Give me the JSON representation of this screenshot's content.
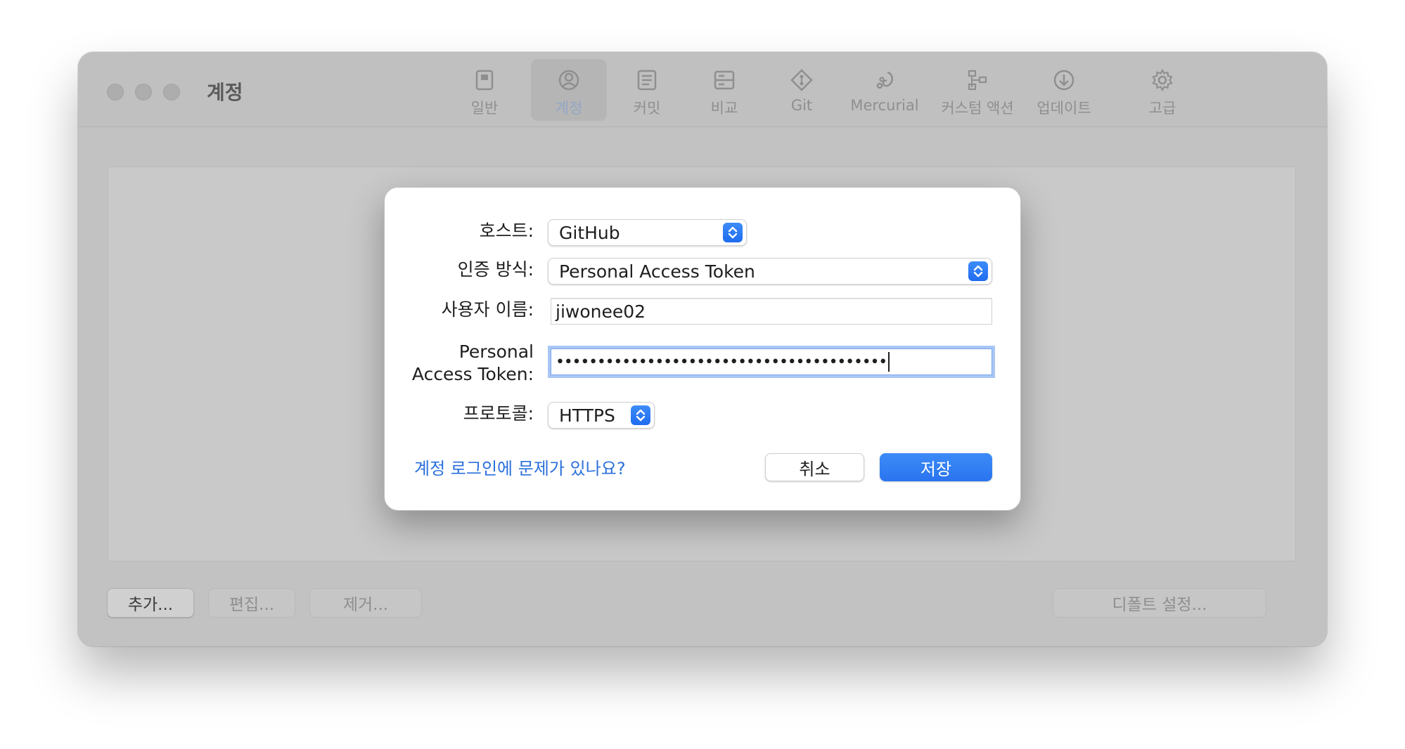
{
  "window": {
    "title": "계정",
    "toolbar": [
      {
        "label": "일반",
        "icon": "general-icon"
      },
      {
        "label": "계정",
        "icon": "accounts-icon",
        "active": true
      },
      {
        "label": "커밋",
        "icon": "commit-icon"
      },
      {
        "label": "비교",
        "icon": "diff-icon"
      },
      {
        "label": "Git",
        "icon": "git-icon"
      },
      {
        "label": "Mercurial",
        "icon": "mercurial-icon"
      },
      {
        "label": "커스텀 액션",
        "icon": "custom-actions-icon"
      },
      {
        "label": "업데이트",
        "icon": "update-icon"
      },
      {
        "label": "고급",
        "icon": "gear-icon"
      }
    ],
    "bottom_buttons": {
      "add": "추가...",
      "edit": "편집...",
      "remove": "제거...",
      "set_default": "디폴트 설정..."
    }
  },
  "dialog": {
    "host_label": "호스트:",
    "host_value": "GitHub",
    "auth_label": "인증 방식:",
    "auth_value": "Personal Access Token",
    "username_label": "사용자 이름:",
    "username_value": "jiwonee02",
    "token_label_line1": "Personal",
    "token_label_line2": "Access Token:",
    "token_value": "••••••••••••••••••••••••••••••••••••••••",
    "protocol_label": "프로토콜:",
    "protocol_value": "HTTPS",
    "help_link": "계정 로그인에 문제가 있나요?",
    "cancel_label": "취소",
    "save_label": "저장"
  },
  "colors": {
    "accent": "#2a74ef",
    "link": "#2a6fdc",
    "focus_ring": "#a9c6f5"
  }
}
